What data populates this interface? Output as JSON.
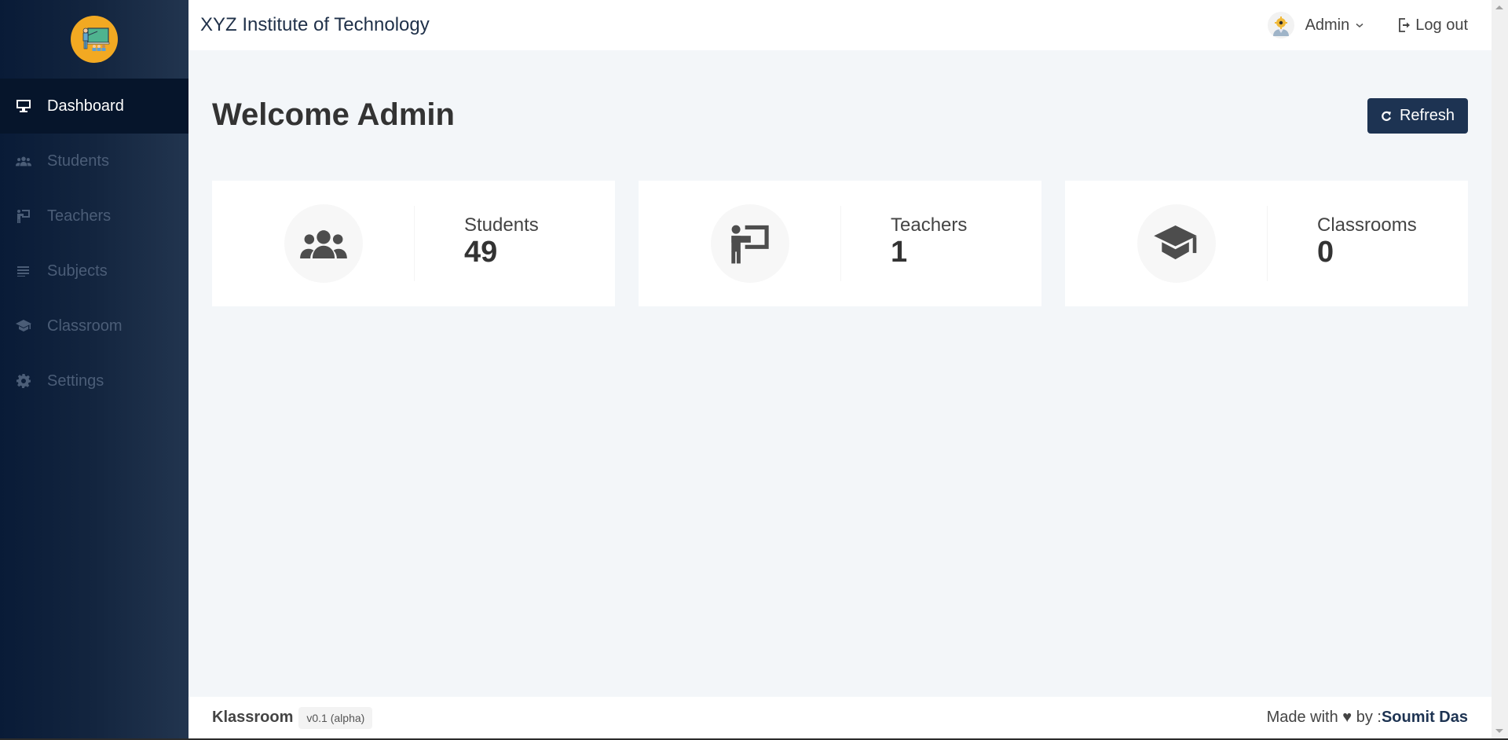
{
  "sidebar": {
    "logo": "teacher-board-logo",
    "items": [
      {
        "label": "Dashboard",
        "icon": "monitor-icon",
        "active": true
      },
      {
        "label": "Students",
        "icon": "users-icon",
        "active": false
      },
      {
        "label": "Teachers",
        "icon": "chalkboard-teacher-icon",
        "active": false
      },
      {
        "label": "Subjects",
        "icon": "list-lines-icon",
        "active": false
      },
      {
        "label": "Classroom",
        "icon": "graduation-cap-icon",
        "active": false
      },
      {
        "label": "Settings",
        "icon": "gear-icon",
        "active": false
      }
    ]
  },
  "header": {
    "title": "XYZ Institute of Technology",
    "user": {
      "name": "Admin",
      "avatar": "admin-gear-avatar"
    },
    "logout_label": "Log out"
  },
  "main": {
    "title": "Welcome Admin",
    "refresh_label": "Refresh",
    "cards": [
      {
        "label": "Students",
        "count": "49",
        "icon": "users-icon"
      },
      {
        "label": "Teachers",
        "count": "1",
        "icon": "chalkboard-teacher-icon"
      },
      {
        "label": "Classrooms",
        "count": "0",
        "icon": "graduation-cap-icon"
      }
    ]
  },
  "footer": {
    "app_name": "Klassroom",
    "version": "v0.1 (alpha)",
    "credit_prefix": "Made with ♥ by :",
    "author": "Soumit Das"
  },
  "colors": {
    "sidebar_dark": "#091b37",
    "sidebar_light": "#22354f",
    "active_item": "#06152b",
    "primary_button": "#1d3352",
    "logo_bg": "#f2a922",
    "page_bg": "#f3f6f9"
  }
}
